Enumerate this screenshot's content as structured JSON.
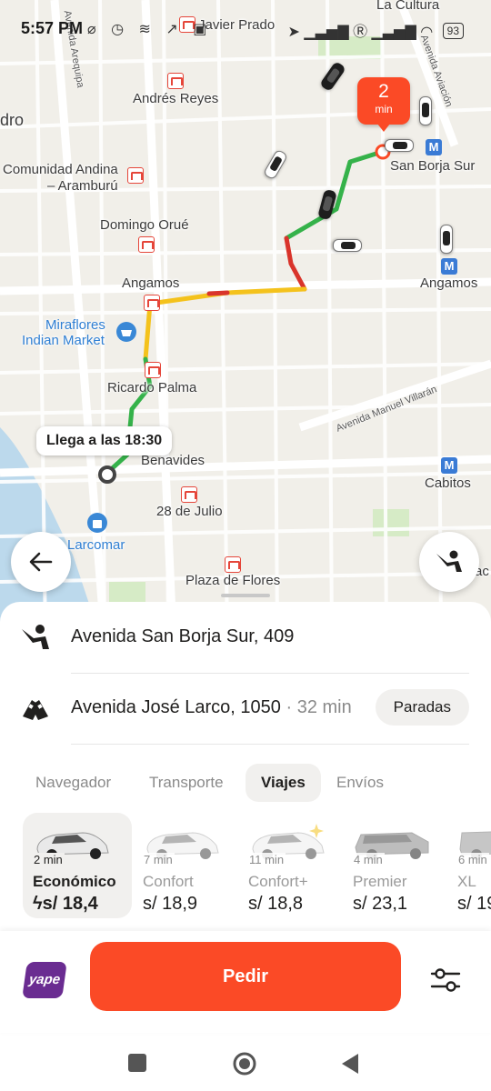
{
  "status_bar": {
    "time": "5:57 PM",
    "battery": "93"
  },
  "map": {
    "labels": {
      "la_cultura": "La Cultura",
      "javier_prado": "Javier Prado",
      "andres_reyes": "Andrés Reyes",
      "dro": "dro",
      "comunidad_andina_1": "Comunidad Andina",
      "comunidad_andina_2": "– Aramburú",
      "domingo_orue": "Domingo Orué",
      "angamos_left": "Angamos",
      "angamos_right": "Angamos",
      "miraflores_1": "Miraflores",
      "miraflores_2": "Indian Market",
      "ricardo_palma": "Ricardo Palma",
      "benavides": "Benavides",
      "veinte_julio": "28 de Julio",
      "larcomar": "Larcomar",
      "plaza_flores": "Plaza de Flores",
      "san_borja_sur": "San Borja Sur",
      "cabitos": "Cabitos",
      "avenida_arequipa": "Avenida Arequipa",
      "avenida_aviacion": "Avenida Aviación",
      "avenida_villaran": "Avenida Manuel Villarán",
      "cut_off": "ac"
    },
    "eta_pin": {
      "value": "2",
      "unit": "min"
    },
    "arrival_bubble": "Llega a las 18:30"
  },
  "route": {
    "pickup": "Avenida San Borja Sur, 409",
    "destination": "Avenida José Larco, 1050",
    "duration": "32 min",
    "separator": " · ",
    "stops_button": "Paradas"
  },
  "tabs": [
    {
      "label": "Navegador",
      "active": false
    },
    {
      "label": "Transporte",
      "active": false
    },
    {
      "label": "Viajes",
      "active": true
    },
    {
      "label": "Envíos",
      "active": false
    }
  ],
  "tariffs": [
    {
      "mins": "2 min",
      "name": "Económico",
      "price": "s/ 18,4",
      "selected": true,
      "surge_icon": "lightning-icon"
    },
    {
      "mins": "7 min",
      "name": "Confort",
      "price": "s/ 18,9",
      "selected": false
    },
    {
      "mins": "11 min",
      "name": "Confort+",
      "price": "s/ 18,8",
      "selected": false
    },
    {
      "mins": "4 min",
      "name": "Premier",
      "price": "s/ 23,1",
      "selected": false
    },
    {
      "mins": "6 min",
      "name": "XL",
      "price": "s/ 19",
      "selected": false
    }
  ],
  "actions": {
    "payment_label": "yape",
    "order_button": "Pedir"
  },
  "colors": {
    "accent": "#fb4a26",
    "route_green": "#35b24a",
    "route_yellow": "#f4c21c",
    "route_red": "#d9342b",
    "yape_purple": "#6a2c91"
  }
}
